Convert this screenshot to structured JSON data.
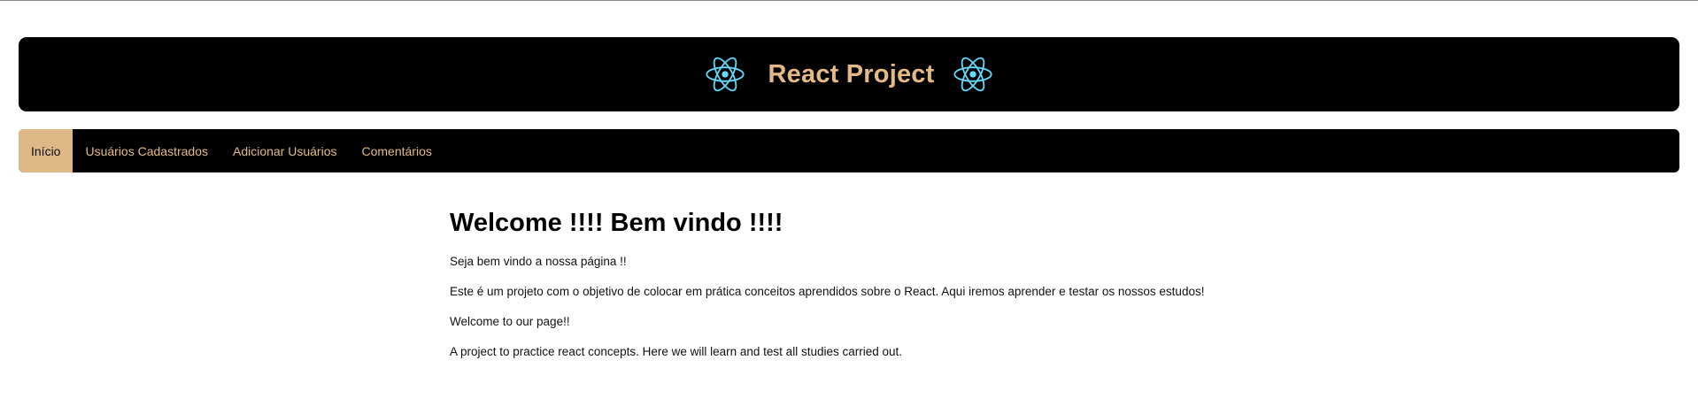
{
  "header": {
    "title": "React Project",
    "logo_color": "#61dafb",
    "title_color": "#e4b985"
  },
  "nav": {
    "items": [
      {
        "label": "Início",
        "active": true
      },
      {
        "label": "Usuários Cadastrados",
        "active": false
      },
      {
        "label": "Adicionar Usuários",
        "active": false
      },
      {
        "label": "Comentários",
        "active": false
      }
    ],
    "active_color": "#deb887"
  },
  "main": {
    "heading": "Welcome !!!! Bem vindo !!!!",
    "paragraphs": [
      "Seja bem vindo a nossa página !!",
      "Este é um projeto com o objetivo de colocar em prática conceitos aprendidos sobre o React. Aqui iremos aprender e testar os nossos estudos!",
      "Welcome to our page!!",
      "A project to practice react concepts. Here we will learn and test all studies carried out."
    ]
  }
}
